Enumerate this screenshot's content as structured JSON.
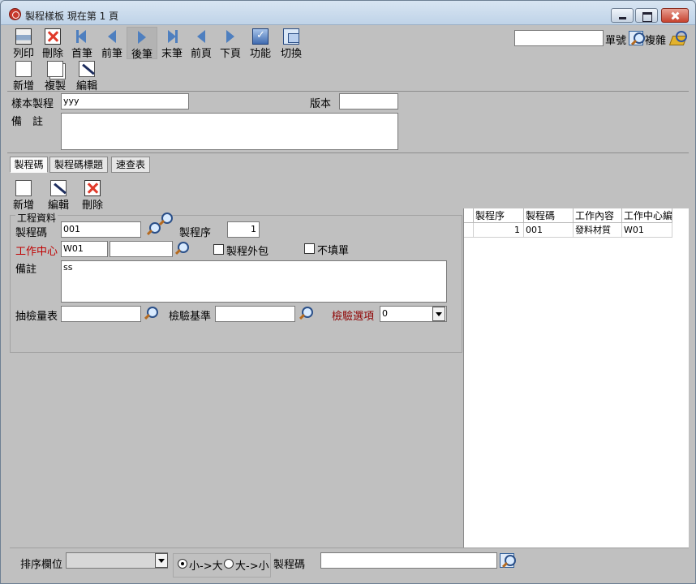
{
  "window": {
    "title": "製程樣板  現在第 1 頁"
  },
  "toolbar": {
    "buttons": [
      {
        "label": "列印",
        "icon": "printer-icon"
      },
      {
        "label": "刪除",
        "icon": "delete-icon"
      },
      {
        "label": "首筆",
        "icon": "first-record-icon"
      },
      {
        "label": "前筆",
        "icon": "previous-record-icon"
      },
      {
        "label": "後筆",
        "icon": "next-record-icon"
      },
      {
        "label": "末筆",
        "icon": "last-record-icon"
      },
      {
        "label": "前頁",
        "icon": "previous-page-icon"
      },
      {
        "label": "下頁",
        "icon": "next-page-icon"
      },
      {
        "label": "功能",
        "icon": "function-icon"
      },
      {
        "label": "切換",
        "icon": "switch-icon"
      }
    ],
    "second_row": [
      {
        "label": "新增",
        "icon": "new-document-icon"
      },
      {
        "label": "複製",
        "icon": "copy-icon"
      },
      {
        "label": "編輯",
        "icon": "edit-icon"
      }
    ],
    "search": {
      "value": "",
      "label_no": "單號",
      "label_complex": "複雜"
    }
  },
  "header": {
    "template_label": "樣本製程",
    "template_value": "yyy",
    "version_label": "版本",
    "version_value": "",
    "note_label": "備　註",
    "note_value": ""
  },
  "tabs": [
    "製程碼",
    "製程碼標題",
    "速查表"
  ],
  "detail_toolbar": [
    "新增",
    "編輯",
    "刪除"
  ],
  "form": {
    "group_title": "工程資料",
    "process_code_label": "製程碼",
    "process_code_value": "001",
    "sequence_label": "製程序",
    "sequence_value": "1",
    "work_center_label": "工作中心",
    "work_center_value": "W01",
    "work_center_desc": "",
    "outsource_label": "製程外包",
    "no_fill_label": "不填單",
    "note_label": "備註",
    "note_value": "ss",
    "sampling_label": "抽檢量表",
    "sampling_value": "",
    "inspection_label": "檢驗基準",
    "inspection_value": "",
    "option_label": "檢驗選項",
    "option_value": "0"
  },
  "grid": {
    "columns": [
      "製程序",
      "製程碼",
      "工作內容",
      "工作中心編"
    ],
    "rows": [
      [
        "1",
        "001",
        "發料材質",
        "W01"
      ]
    ]
  },
  "bottom": {
    "sort_label": "排序欄位",
    "sort_value": "",
    "asc_label": "小->大",
    "desc_label": "大->小",
    "search_label": "製程碼",
    "search_value": ""
  },
  "colors": {
    "window": "#c0c0c0",
    "titlebar": "#d8e5f2",
    "required": "#c00000"
  }
}
